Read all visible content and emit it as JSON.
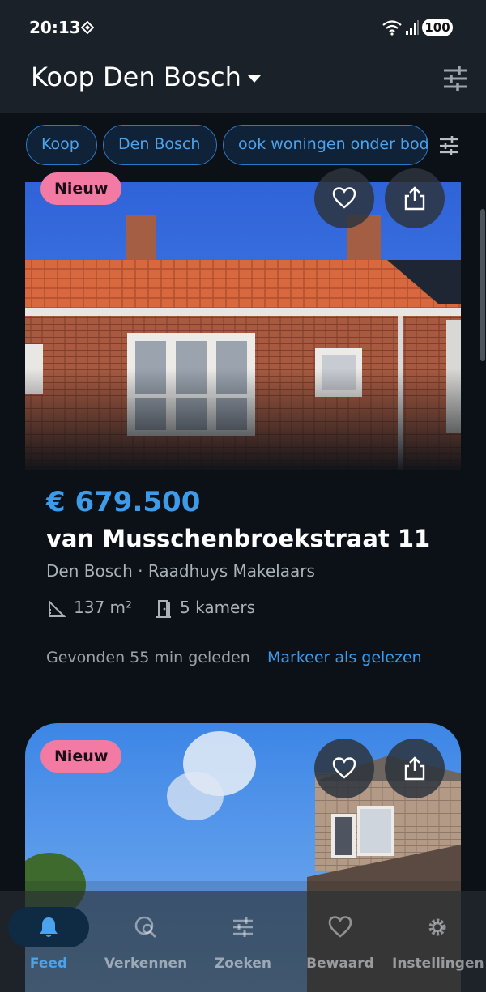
{
  "status_bar": {
    "time": "20:13",
    "battery": "100"
  },
  "app_bar": {
    "title": "Koop Den Bosch"
  },
  "chips": [
    "Koop",
    "Den Bosch",
    "ook woningen onder bod"
  ],
  "listings": [
    {
      "badge": "Nieuw",
      "price": "€ 679.500",
      "address": "van Musschenbroekstraat 11",
      "location": "Den Bosch · Raadhuys Makelaars",
      "area": "137 m²",
      "rooms": "5 kamers",
      "found": "Gevonden 55 min geleden",
      "mark_read": "Markeer als gelezen"
    },
    {
      "badge": "Nieuw"
    }
  ],
  "bottom_nav": [
    {
      "label": "Feed",
      "icon": "bell-icon",
      "active": true
    },
    {
      "label": "Verkennen",
      "icon": "explore-icon",
      "active": false
    },
    {
      "label": "Zoeken",
      "icon": "filter-icon",
      "active": false
    },
    {
      "label": "Bewaard",
      "icon": "heart-icon",
      "active": false
    },
    {
      "label": "Instellingen",
      "icon": "gear-icon",
      "active": false
    }
  ],
  "colors": {
    "accent": "#3d9be9",
    "badge": "#f27aa3",
    "background": "#0c1117",
    "app_bar": "#1b2128"
  }
}
